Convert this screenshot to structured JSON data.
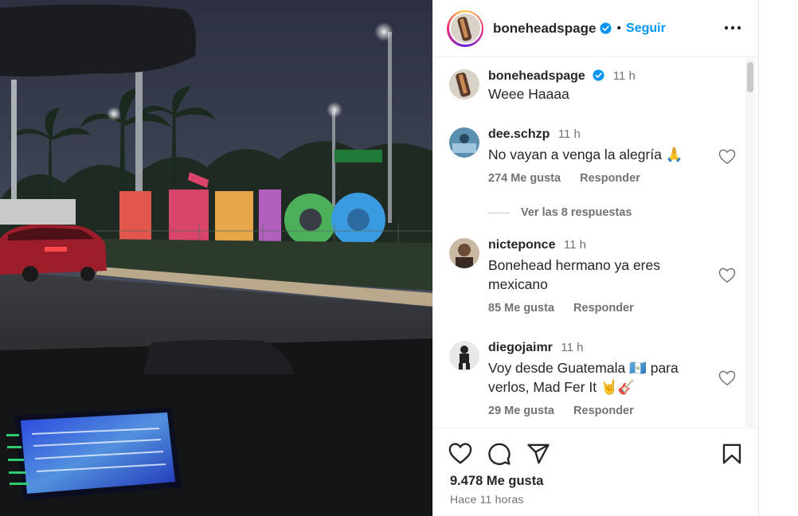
{
  "post": {
    "username": "boneheadspage",
    "follow_label": "Seguir",
    "separator": "•",
    "caption": "Weee Haaaa",
    "caption_time": "11 h",
    "likes": "9.478 Me gusta",
    "time_ago": "Hace 11 horas",
    "photo_sign_text": "MéXICO",
    "photo_road_sign": "→"
  },
  "comments": [
    {
      "user": "dee.schzp",
      "time": "11 h",
      "text": "No vayan a venga la alegría 🙏",
      "likes": "274 Me gusta",
      "reply": "Responder"
    },
    {
      "user": "nicteponce",
      "time": "11 h",
      "text": "Bonehead hermano ya eres mexicano",
      "likes": "85 Me gusta",
      "reply": "Responder"
    },
    {
      "user": "diegojaimr",
      "time": "11 h",
      "text": "Voy desde Guatemala 🇬🇹 para verlos, Mad Fer It 🤘🎸",
      "likes": "29 Me gusta",
      "reply": "Responder"
    }
  ],
  "view_replies": "Ver las 8 respuestas",
  "colors": {
    "accent": "#0095f6",
    "verified": "#0095f6",
    "muted": "#737373"
  },
  "icons": [
    "more-options-icon",
    "heart-icon",
    "comment-icon",
    "share-icon",
    "save-icon",
    "verified-badge-icon"
  ]
}
